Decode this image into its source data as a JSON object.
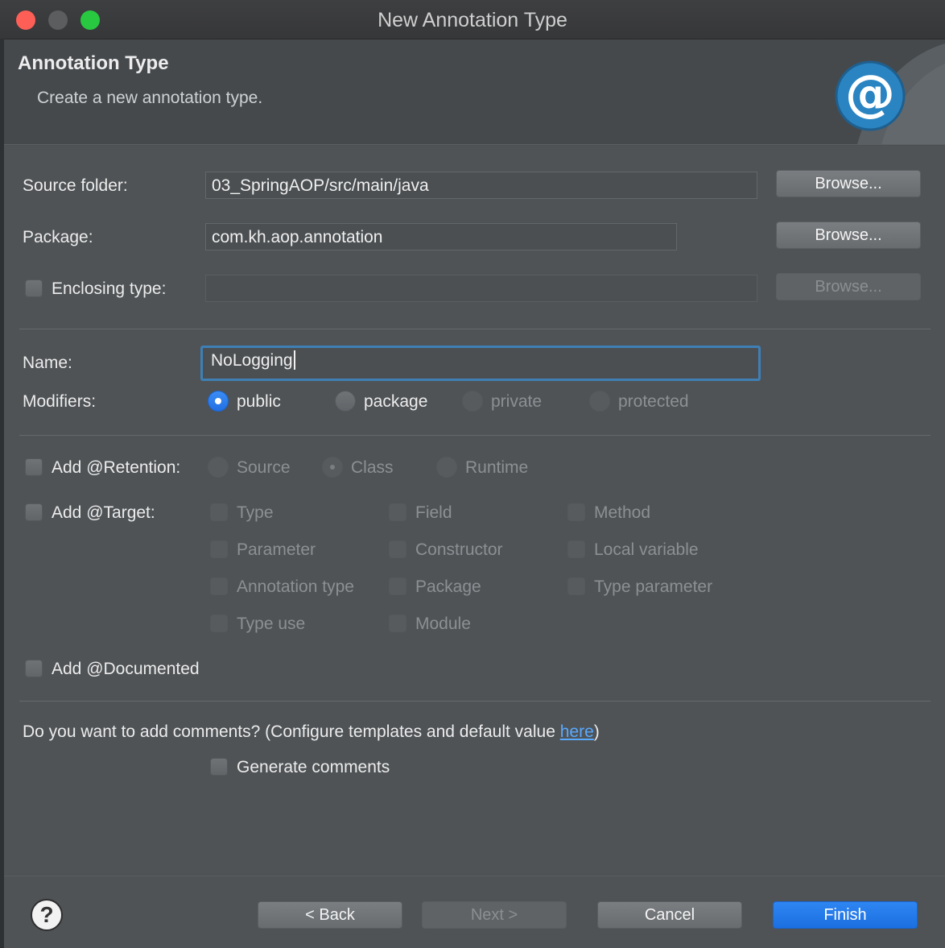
{
  "window": {
    "title": "New Annotation Type"
  },
  "header": {
    "title": "Annotation Type",
    "subtitle": "Create a new annotation type.",
    "icon": "at-sign-icon",
    "icon_glyph": "@"
  },
  "form": {
    "source_folder": {
      "label": "Source folder:",
      "value": "03_SpringAOP/src/main/java",
      "browse": "Browse..."
    },
    "package": {
      "label": "Package:",
      "value": "com.kh.aop.annotation",
      "browse": "Browse..."
    },
    "enclosing_type": {
      "label": "Enclosing type:",
      "value": "",
      "browse": "Browse...",
      "checked": false
    },
    "name": {
      "label": "Name:",
      "value": "NoLogging"
    },
    "modifiers": {
      "label": "Modifiers:",
      "options": [
        "public",
        "package",
        "private",
        "protected"
      ],
      "selected": "public"
    },
    "retention": {
      "label": "Add @Retention:",
      "checked": false,
      "options": [
        "Source",
        "Class",
        "Runtime"
      ],
      "selected": "Class"
    },
    "target": {
      "label": "Add @Target:",
      "checked": false,
      "options": [
        "Type",
        "Field",
        "Method",
        "Parameter",
        "Constructor",
        "Local variable",
        "Annotation type",
        "Package",
        "Type parameter",
        "Type use",
        "Module"
      ]
    },
    "documented": {
      "label": "Add @Documented",
      "checked": false
    },
    "comments": {
      "question_prefix": "Do you want to add comments? (Configure templates and default value ",
      "link": "here",
      "question_suffix": ")",
      "generate_label": "Generate comments",
      "checked": false
    }
  },
  "footer": {
    "help": "?",
    "back": "< Back",
    "next": "Next >",
    "cancel": "Cancel",
    "finish": "Finish"
  },
  "colors": {
    "accent": "#2170e4",
    "link": "#59a9ff",
    "focus_ring": "#3f7fb5",
    "close": "#fd5f57",
    "maximize": "#28c940"
  }
}
